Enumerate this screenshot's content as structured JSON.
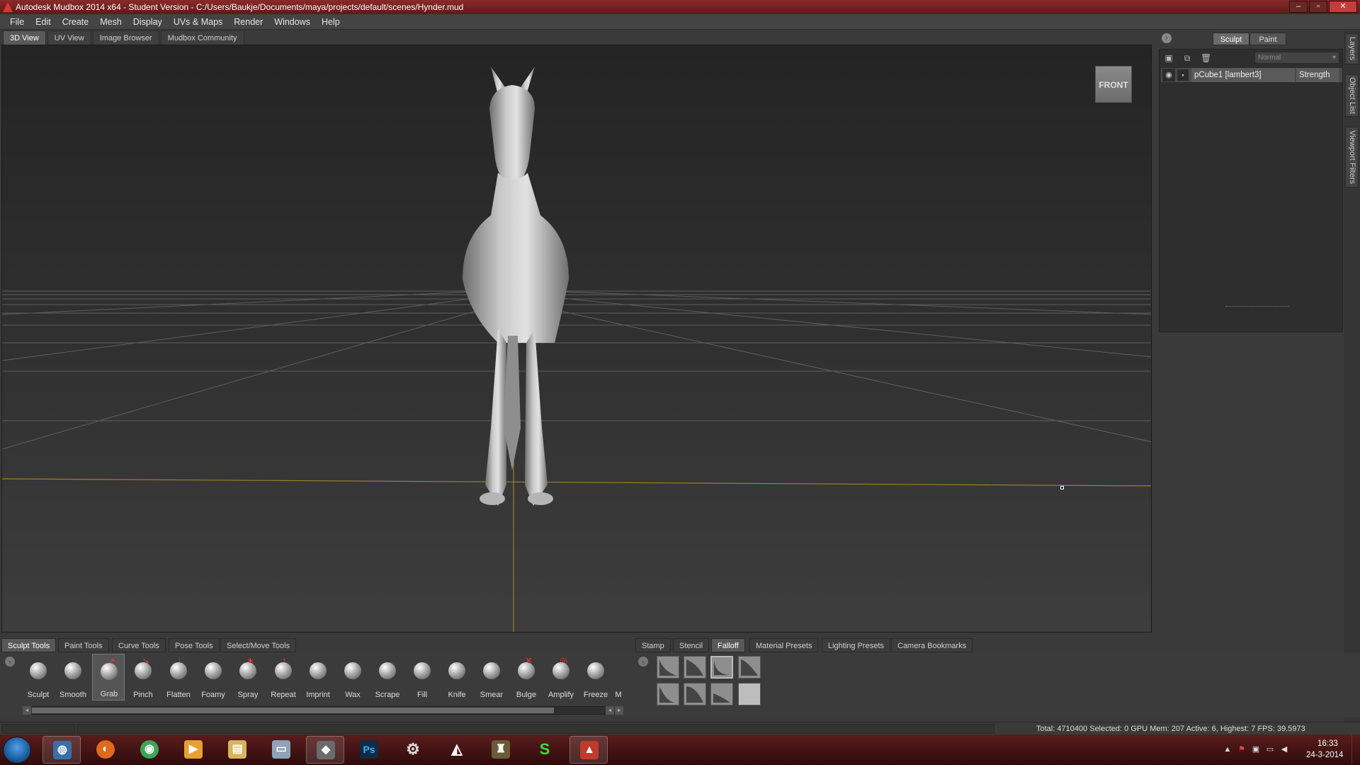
{
  "window": {
    "title": "Autodesk Mudbox 2014 x64 - Student Version - C:/Users/Baukje/Documents/maya/projects/default/scenes/Hynder.mud"
  },
  "menu": [
    "File",
    "Edit",
    "Create",
    "Mesh",
    "Display",
    "UVs & Maps",
    "Render",
    "Windows",
    "Help"
  ],
  "view_tabs": {
    "items": [
      "3D View",
      "UV View",
      "Image Browser",
      "Mudbox Community"
    ],
    "active": "3D View"
  },
  "viewport": {
    "view_cube_label": "FRONT"
  },
  "right_panel": {
    "modes": [
      "Sculpt",
      "Paint"
    ],
    "blend_mode": "Normal",
    "layer_name": "pCube1 [lambert3]",
    "layer_column": "Strength",
    "side_tabs": [
      "Layers",
      "Object List",
      "Viewport Filters"
    ]
  },
  "bottom_tabs_left": {
    "items": [
      "Sculpt Tools",
      "Paint Tools",
      "Curve Tools",
      "Pose Tools",
      "Select/Move Tools"
    ],
    "active": "Sculpt Tools"
  },
  "bottom_tabs_right": {
    "items": [
      "Stamp",
      "Stencil",
      "Falloff",
      "Material Presets",
      "Lighting Presets",
      "Camera Bookmarks"
    ],
    "active": "Falloff"
  },
  "tools": {
    "items": [
      "Sculpt",
      "Smooth",
      "Grab",
      "Pinch",
      "Flatten",
      "Foamy",
      "Spray",
      "Repeat",
      "Imprint",
      "Wax",
      "Scrape",
      "Fill",
      "Knife",
      "Smear",
      "Bulge",
      "Amplify",
      "Freeze",
      "M"
    ],
    "active": "Grab"
  },
  "status": {
    "text": "Total: 4710400  Selected: 0 GPU Mem: 207  Active: 6, Highest: 7  FPS: 39.5973"
  },
  "taskbar": {
    "time": "16:33",
    "date": "24-3-2014",
    "apps": [
      "globe",
      "firefox",
      "chrome",
      "media-player",
      "explorer",
      "window",
      "game",
      "photoshop",
      "settings",
      "unity",
      "app",
      "sketchup",
      "mudbox"
    ]
  },
  "colors": {
    "title_bar": "#5c1a1a",
    "taskbar": "#2e0c0c",
    "viewport_top": "#242424",
    "grid_line": "#8a8a8a",
    "ground_axis": "#b8902a"
  }
}
